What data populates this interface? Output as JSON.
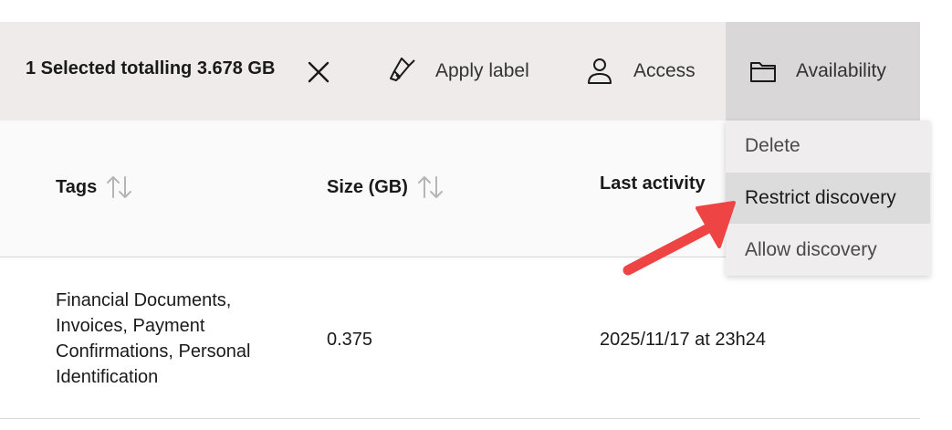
{
  "selection": {
    "summary": "1 Selected totalling 3.678 GB"
  },
  "actions": [
    {
      "label": "Apply label",
      "icon": "label-brush-icon"
    },
    {
      "label": "Access",
      "icon": "person-icon"
    },
    {
      "label": "Availability",
      "icon": "folder-icon"
    }
  ],
  "table": {
    "columns": [
      "Tags",
      "Size (GB)",
      "Last activity"
    ],
    "rows": [
      {
        "tags": "Financial Documents, Invoices, Payment Confirmations, Personal Identification",
        "size": "0.375",
        "last_activity": "2025/11/17 at 23h24"
      }
    ]
  },
  "dropdown": {
    "items": [
      "Delete",
      "Restrict discovery",
      "Allow discovery"
    ],
    "highlighted_index": 1
  },
  "colors": {
    "action_bar_bg": "#efebeb",
    "active_action_bg": "#d9d7d7",
    "menu_highlight": "#dcdcdc",
    "annotation_arrow": "#ef4444"
  }
}
